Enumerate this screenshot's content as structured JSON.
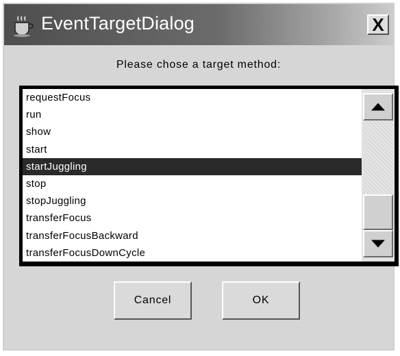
{
  "window": {
    "title": "EventTargetDialog",
    "close_label": "X"
  },
  "prompt": "Please chose a target method:",
  "methods": {
    "items": [
      "requestFocus",
      "run",
      "show",
      "start",
      "startJuggling",
      "stop",
      "stopJuggling",
      "transferFocus",
      "transferFocusBackward",
      "transferFocusDownCycle"
    ],
    "selected": "startJuggling"
  },
  "buttons": {
    "cancel_label": "Cancel",
    "ok_label": "OK"
  },
  "icons": {
    "app": "java-cup-icon",
    "close": "close-icon",
    "scroll_up": "arrow-up-icon",
    "scroll_down": "arrow-down-icon"
  }
}
